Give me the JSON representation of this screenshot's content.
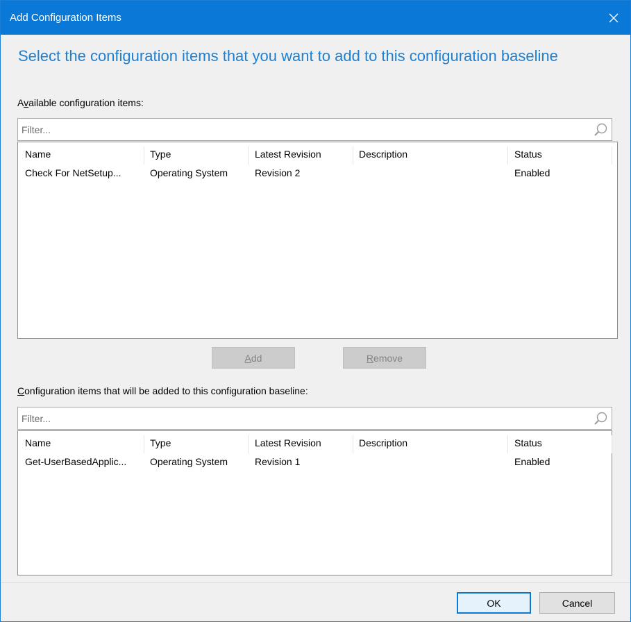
{
  "window": {
    "title": "Add Configuration Items",
    "heading": "Select the configuration items that you want to add to this configuration baseline"
  },
  "available": {
    "label_prefix": "A",
    "label_accel": "v",
    "label_rest": "ailable configuration items:",
    "filter_placeholder": "Filter...",
    "columns": [
      "Name",
      "Type",
      "Latest Revision",
      "Description",
      "Status"
    ],
    "rows": [
      [
        "Check For NetSetup...",
        "Operating System",
        "Revision 2",
        "",
        "Enabled"
      ]
    ]
  },
  "actions": {
    "add_accel": "A",
    "add_rest": "dd",
    "remove_accel": "R",
    "remove_rest": "emove"
  },
  "selected": {
    "label_accel": "C",
    "label_rest": "onfiguration items that will be added to this configuration baseline:",
    "filter_placeholder": "Filter...",
    "columns": [
      "Name",
      "Type",
      "Latest Revision",
      "Description",
      "Status"
    ],
    "rows": [
      [
        "Get-UserBasedApplic...",
        "Operating System",
        "Revision 1",
        "",
        "Enabled"
      ]
    ]
  },
  "footer": {
    "ok_label": "OK",
    "cancel_label": "Cancel"
  },
  "colors": {
    "titlebar": "#0a78d7",
    "heading": "#1f7fd0",
    "dialog_bg": "#f0f0f0"
  },
  "icons": {
    "close": "close-icon",
    "search": "search-icon"
  }
}
